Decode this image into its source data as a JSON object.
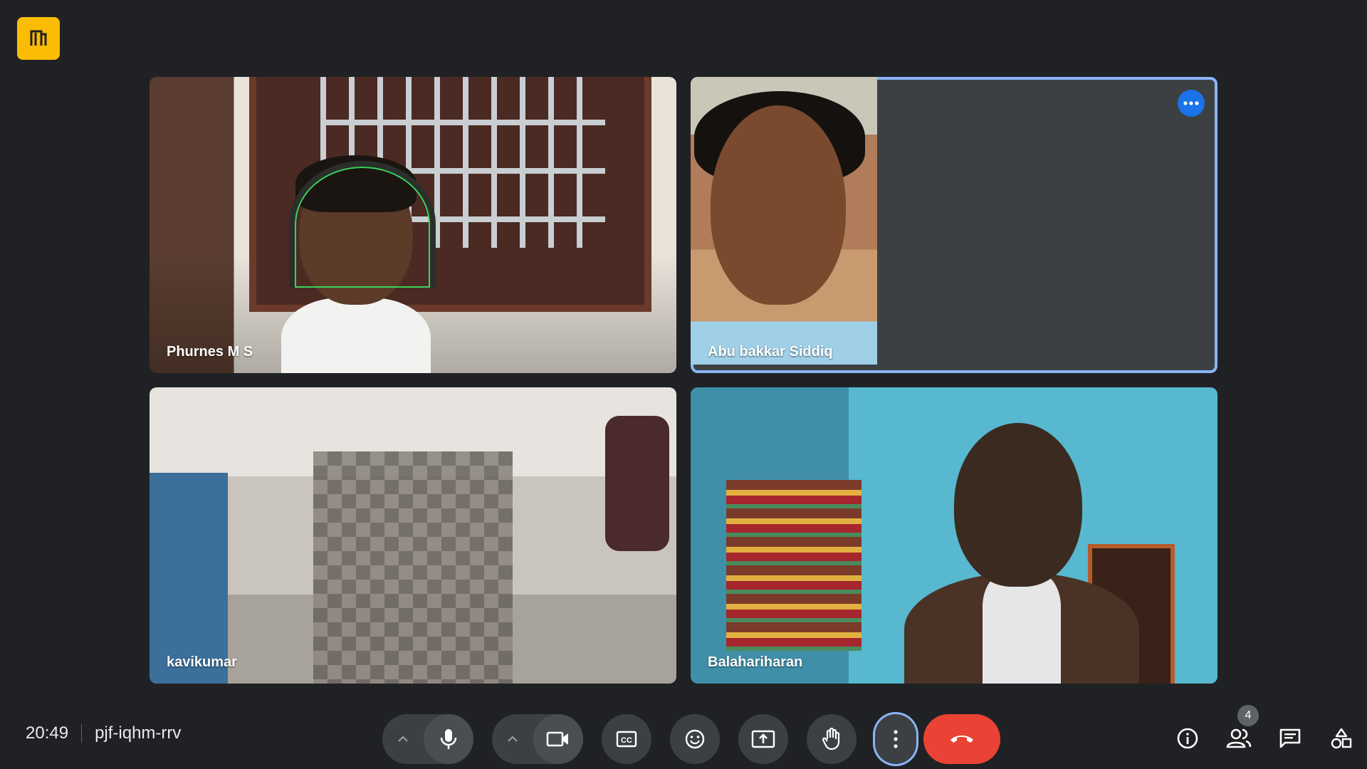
{
  "meeting": {
    "time": "20:49",
    "code": "pjf-iqhm-rrv"
  },
  "participants": [
    {
      "name": "Phurnes M S"
    },
    {
      "name": "Abu bakkar Siddiq"
    },
    {
      "name": "kavikumar"
    },
    {
      "name": "Balahariharan"
    }
  ],
  "toolbar": {
    "mic_options_icon": "chevron-up-icon",
    "mic_icon": "microphone-icon",
    "camera_options_icon": "chevron-up-icon",
    "camera_icon": "video-camera-icon",
    "captions_icon": "closed-captions-icon",
    "reactions_icon": "emoji-icon",
    "present_icon": "present-screen-icon",
    "raise_hand_icon": "hand-icon",
    "more_icon": "more-vertical-icon",
    "end_call_icon": "phone-hangup-icon"
  },
  "side_panel": {
    "participant_count": "4",
    "info_icon": "info-icon",
    "people_icon": "people-icon",
    "chat_icon": "chat-icon",
    "activities_icon": "activities-icon"
  },
  "colors": {
    "background": "#202124",
    "button": "#3c4043",
    "end_call": "#ea4335",
    "active_speaker": "#8ab4f8",
    "accent": "#1a73e8",
    "logo": "#fbbc04"
  }
}
